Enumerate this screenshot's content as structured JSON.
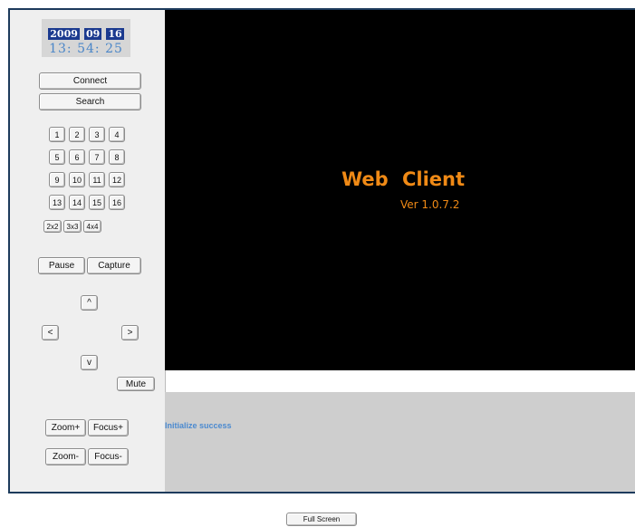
{
  "clock": {
    "year": "2009",
    "month": "09",
    "day": "16",
    "time": "13: 54: 25"
  },
  "connect_label": "Connect",
  "search_label": "Search",
  "channels": [
    "1",
    "2",
    "3",
    "4",
    "5",
    "6",
    "7",
    "8",
    "9",
    "10",
    "11",
    "12",
    "13",
    "14",
    "15",
    "16"
  ],
  "layouts": [
    "2x2",
    "3x3",
    "4x4"
  ],
  "pause_label": "Pause",
  "capture_label": "Capture",
  "ptz": {
    "up": "^",
    "left": "<",
    "right": ">",
    "down": "v"
  },
  "mute_label": "Mute",
  "zoom_plus_label": "Zoom+",
  "focus_plus_label": "Focus+",
  "zoom_minus_label": "Zoom-",
  "focus_minus_label": "Focus-",
  "video": {
    "title": "Web Client",
    "version": "Ver 1.0.7.2"
  },
  "status_text": "Initialize success",
  "fullscreen_label": "Full Screen"
}
